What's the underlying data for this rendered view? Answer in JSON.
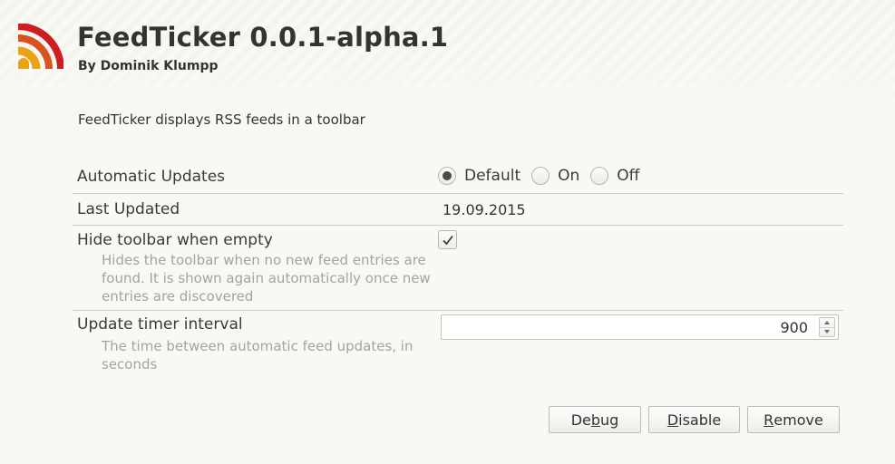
{
  "addon": {
    "title": "FeedTicker 0.0.1-alpha.1",
    "author": "By Dominik Klumpp",
    "description": "FeedTicker displays RSS feeds in a toolbar",
    "logo_icon": "rss-feed-icon",
    "logo_colors": [
      "#e8a317",
      "#d9531e",
      "#cc1f1f"
    ]
  },
  "settings": {
    "automatic_updates": {
      "label": "Automatic Updates",
      "options": [
        "Default",
        "On",
        "Off"
      ],
      "selected": "Default"
    },
    "last_updated": {
      "label": "Last Updated",
      "value": "19.09.2015"
    },
    "hide_toolbar": {
      "label": "Hide toolbar when empty",
      "description": "Hides the toolbar when no new feed entries are found. It is shown again automatically once new entries are discovered",
      "checked": true
    },
    "update_timer": {
      "label": "Update timer interval",
      "description": "The time between automatic feed updates, in seconds",
      "value": "900"
    }
  },
  "buttons": {
    "debug": {
      "pre": "De",
      "ul": "b",
      "post": "ug"
    },
    "disable": {
      "pre": "",
      "ul": "D",
      "post": "isable"
    },
    "remove": {
      "pre": "",
      "ul": "R",
      "post": "emove"
    }
  }
}
